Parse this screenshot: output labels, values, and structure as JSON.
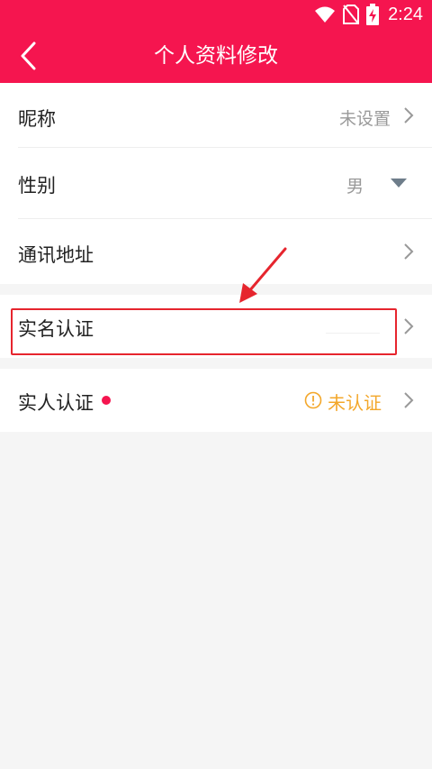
{
  "status_bar": {
    "time": "2:24"
  },
  "header": {
    "title": "个人资料修改"
  },
  "rows": {
    "nickname": {
      "label": "昵称",
      "value": "未设置"
    },
    "gender": {
      "label": "性别",
      "value": "男"
    },
    "address": {
      "label": "通讯地址"
    },
    "realname_auth": {
      "label": "实名认证"
    },
    "person_auth": {
      "label": "实人认证",
      "status": "未认证"
    }
  },
  "colors": {
    "brand": "#f5154f",
    "warning": "#f3a72a",
    "annotation": "#e6252e"
  }
}
